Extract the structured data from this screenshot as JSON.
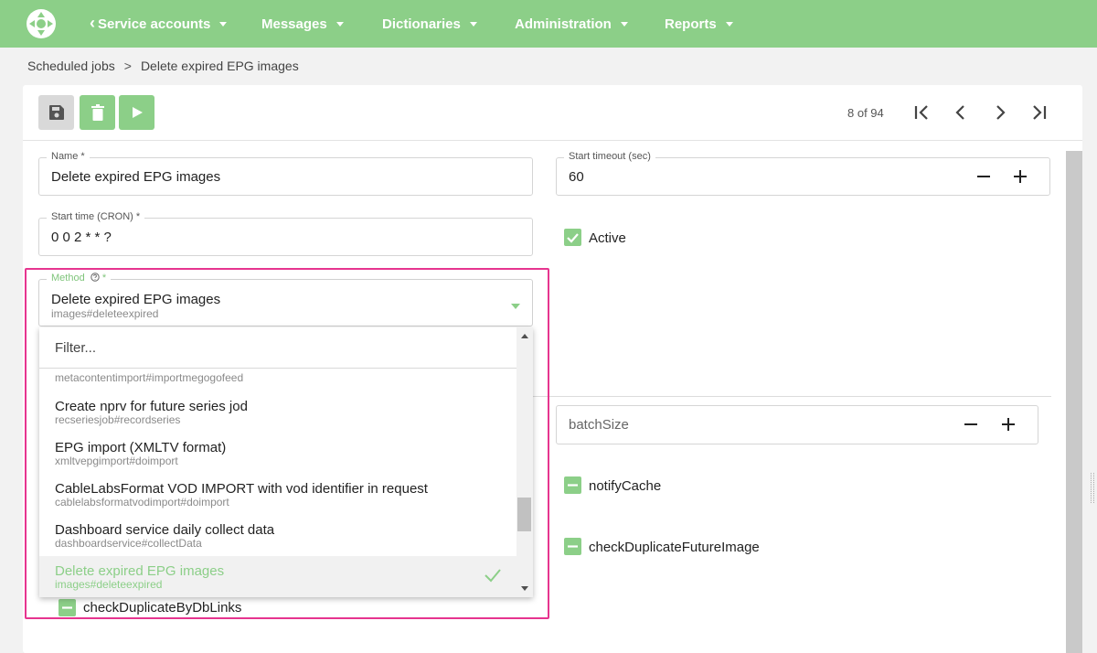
{
  "nav": {
    "back_icon": "chevron-left-icon",
    "items": [
      "Service accounts",
      "Messages",
      "Dictionaries",
      "Administration",
      "Reports"
    ]
  },
  "breadcrumb": {
    "parent": "Scheduled jobs",
    "separator": ">",
    "current": "Delete expired EPG images"
  },
  "toolbar": {
    "save_icon": "floppy-disk-icon",
    "delete_icon": "trash-icon",
    "run_icon": "play-icon"
  },
  "pager": {
    "text": "8 of 94"
  },
  "form": {
    "name": {
      "label": "Name *",
      "value": "Delete expired EPG images"
    },
    "start_timeout": {
      "label": "Start timeout (sec)",
      "value": "60"
    },
    "start_time": {
      "label": "Start time (CRON) *",
      "value": "0 0 2 * * ?"
    },
    "active": {
      "label": "Active",
      "checked": true
    },
    "method": {
      "label": "Method",
      "required_mark": "*",
      "help_icon": "question-circle-icon",
      "title": "Delete expired EPG images",
      "subtitle": "images#deleteexpired"
    },
    "batch_size": {
      "placeholder": "batchSize"
    },
    "notify_cache": {
      "label": "notifyCache",
      "state": "indeterminate"
    },
    "check_duplicate_future_image": {
      "label": "checkDuplicateFutureImage",
      "state": "indeterminate"
    },
    "check_duplicate_by_db_links": {
      "label": "checkDuplicateByDbLinks",
      "state": "indeterminate"
    }
  },
  "dropdown": {
    "filter_placeholder": "Filter...",
    "options": [
      {
        "title": "",
        "subtitle": "metacontentimport#importmegogofeed"
      },
      {
        "title": "Create nprv for future series jod",
        "subtitle": "recseriesjob#recordseries"
      },
      {
        "title": "EPG import (XMLTV format)",
        "subtitle": "xmltvepgimport#doimport"
      },
      {
        "title": "CableLabsFormat VOD IMPORT with vod identifier in request",
        "subtitle": "cablelabsformatvodimport#doimport"
      },
      {
        "title": "Dashboard service daily collect data",
        "subtitle": "dashboardservice#collectData"
      },
      {
        "title": "Delete expired EPG images",
        "subtitle": "images#deleteexpired",
        "selected": true
      }
    ]
  },
  "colors": {
    "accent": "#8ccf88",
    "highlight": "#e6358f"
  }
}
